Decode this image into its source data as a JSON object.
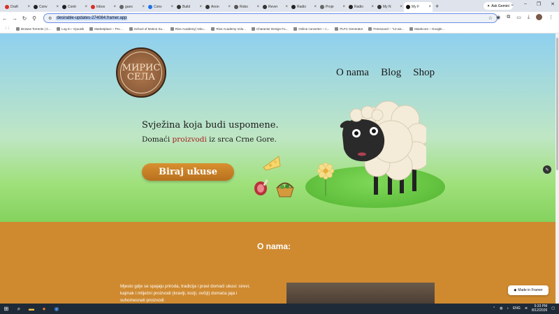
{
  "browser": {
    "tabs": [
      {
        "label": "Draft"
      },
      {
        "label": "Conv"
      },
      {
        "label": "Contr"
      },
      {
        "label": "Inbox"
      },
      {
        "label": "gues"
      },
      {
        "label": "Conv"
      },
      {
        "label": "Build"
      },
      {
        "label": "Anon"
      },
      {
        "label": "Robo"
      },
      {
        "label": "Rever"
      },
      {
        "label": "Radio"
      },
      {
        "label": "Proje"
      },
      {
        "label": "Radio"
      },
      {
        "label": "My N"
      },
      {
        "label": "My F"
      }
    ],
    "gemini_label": "Ask Gemini",
    "url": "desirable-updates-274084.framer.app",
    "bookmarks": [
      "Browse Torrents | C...",
      "Log In ‹ Vyousik",
      "Marketplace – Pro ...",
      "School of Motion Su...",
      "Rive Academy| Volu...",
      "Rive Academy Volu...",
      "Character Design Fu...",
      "Online converter – c...",
      "PLFC Generator",
      "Freesound – \"13 wa...",
      "Manticore – Google..."
    ]
  },
  "site": {
    "logo": {
      "line1": "МИРИС",
      "line2": "СЕЛА"
    },
    "nav": [
      {
        "label": "O nama"
      },
      {
        "label": "Blog"
      },
      {
        "label": "Shop"
      }
    ],
    "headline": "Svježina koja budi uspomene.",
    "subline_pre": "Domaći ",
    "subline_accent": "proizvodi",
    "subline_post": " iz srca Crne Gore.",
    "cta": "Biraj ukuse",
    "about_title": "O nama:",
    "about_text": "Mjesto gdje se spajaju priroda, tradicija i pravi domaći ukusi: sirevi, kajmak i mliječni proizvodi (kravlji, kozji, ovčiji) domaća jaja i suhomesnati proizvodi",
    "framer_badge": "Made in Framer",
    "colors": {
      "accent": "#a3201f",
      "about_bg": "#cf8a30",
      "cta": "#c9822a"
    }
  },
  "taskbar": {
    "lang": "ENG",
    "time": "5:33 PM",
    "date": "8/12/2026"
  }
}
